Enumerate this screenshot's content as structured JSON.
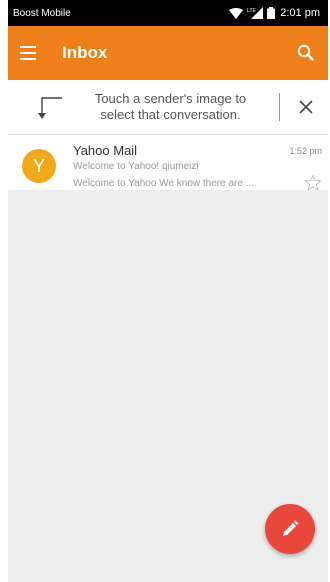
{
  "status_bar": {
    "carrier": "Boost Mobile",
    "network": "LTE",
    "time": "2:01 pm"
  },
  "app_bar": {
    "title": "Inbox"
  },
  "tip": {
    "text": "Touch a sender's image to\nselect that conversation."
  },
  "messages": [
    {
      "avatar_letter": "Y",
      "sender": "Yahoo Mail",
      "time": "1:52 pm",
      "subject": "Welcome to Yahoo! qiumeizi",
      "preview": "Welcome to Yahoo We know there are ...",
      "starred": false
    }
  ],
  "colors": {
    "app_bar": "#ef7f1a",
    "avatar": "#f2a818",
    "fab": "#e8473b",
    "background": "#eeeeee"
  },
  "icons": {
    "menu": "menu-icon",
    "search": "search-icon",
    "close": "close-icon",
    "star": "star-icon",
    "compose": "pencil-icon"
  }
}
